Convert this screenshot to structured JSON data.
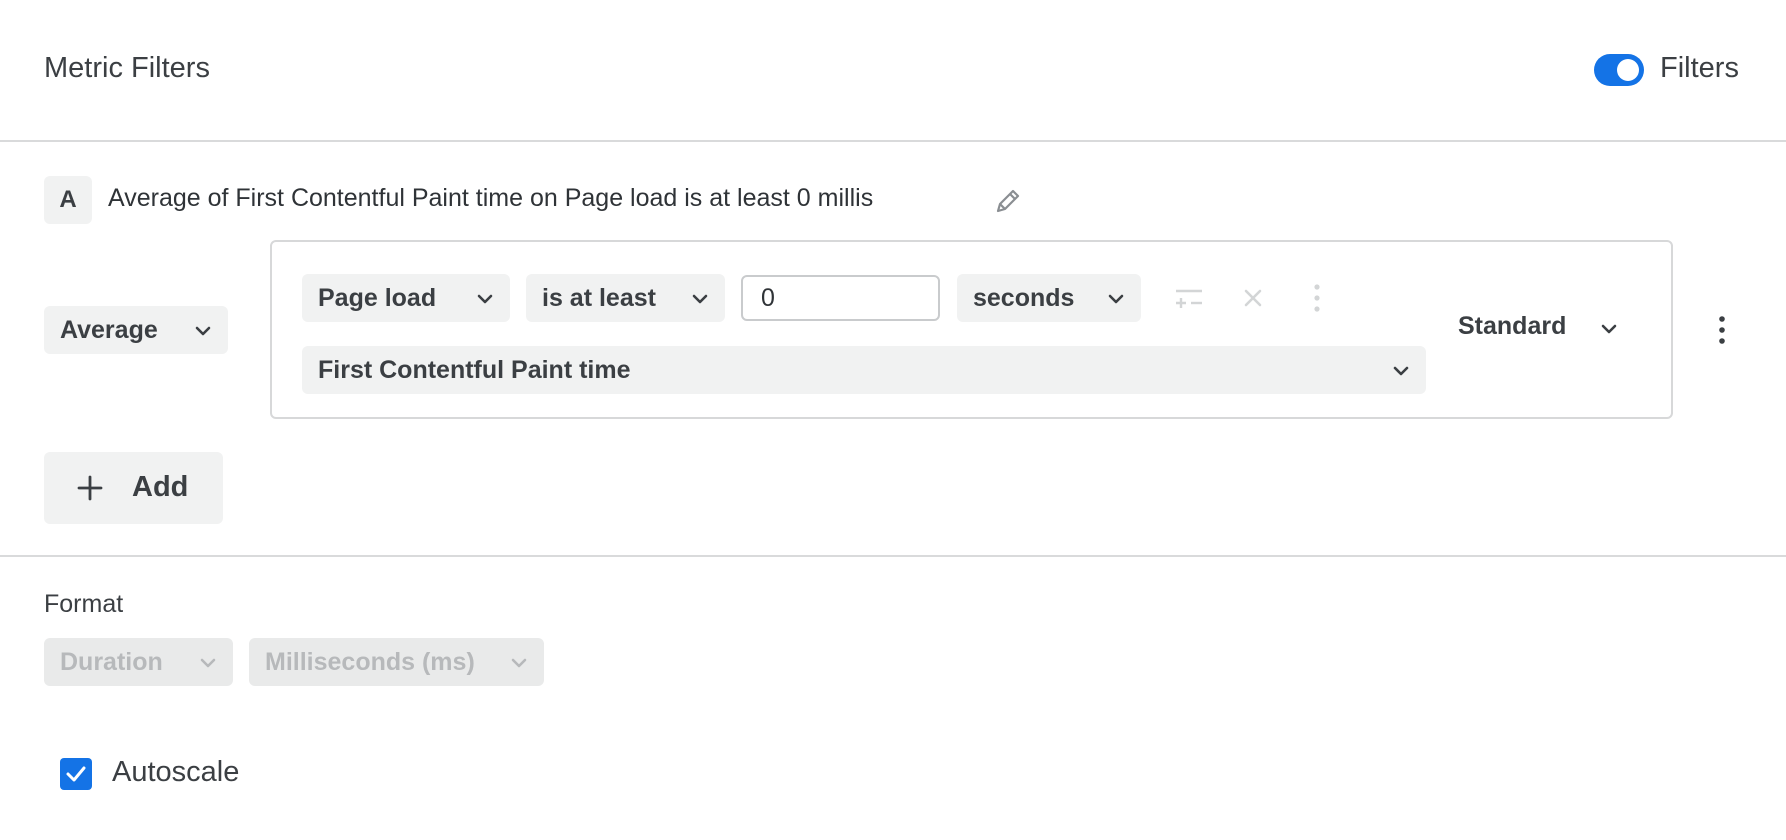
{
  "header": {
    "title": "Metric Filters",
    "toggle_label": "Filters",
    "toggle_on": true
  },
  "metric": {
    "badge": "A",
    "summary": "Average of First Contentful Paint time on Page load is at least 0 millis",
    "aggregation": "Average",
    "filter": {
      "event": "Page load",
      "operator": "is at least",
      "value": "0",
      "unit": "seconds",
      "metric": "First Contentful Paint time"
    },
    "mode": "Standard"
  },
  "add_button": {
    "label": "Add"
  },
  "format": {
    "label": "Format",
    "type": "Duration",
    "unit": "Milliseconds (ms)"
  },
  "autoscale": {
    "label": "Autoscale",
    "checked": true
  },
  "colors": {
    "accent": "#1473e6",
    "chip_bg": "#f1f2f2",
    "border": "#d9dadb"
  }
}
